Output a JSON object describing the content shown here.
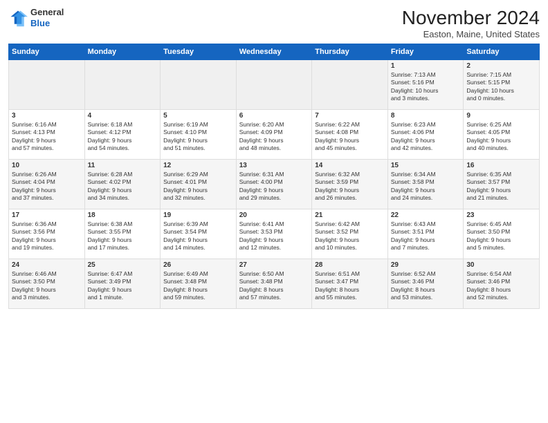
{
  "header": {
    "logo_line1": "General",
    "logo_line2": "Blue",
    "title": "November 2024",
    "subtitle": "Easton, Maine, United States"
  },
  "days_of_week": [
    "Sunday",
    "Monday",
    "Tuesday",
    "Wednesday",
    "Thursday",
    "Friday",
    "Saturday"
  ],
  "weeks": [
    [
      {
        "num": "",
        "info": ""
      },
      {
        "num": "",
        "info": ""
      },
      {
        "num": "",
        "info": ""
      },
      {
        "num": "",
        "info": ""
      },
      {
        "num": "",
        "info": ""
      },
      {
        "num": "1",
        "info": "Sunrise: 7:13 AM\nSunset: 5:16 PM\nDaylight: 10 hours\nand 3 minutes."
      },
      {
        "num": "2",
        "info": "Sunrise: 7:15 AM\nSunset: 5:15 PM\nDaylight: 10 hours\nand 0 minutes."
      }
    ],
    [
      {
        "num": "3",
        "info": "Sunrise: 6:16 AM\nSunset: 4:13 PM\nDaylight: 9 hours\nand 57 minutes."
      },
      {
        "num": "4",
        "info": "Sunrise: 6:18 AM\nSunset: 4:12 PM\nDaylight: 9 hours\nand 54 minutes."
      },
      {
        "num": "5",
        "info": "Sunrise: 6:19 AM\nSunset: 4:10 PM\nDaylight: 9 hours\nand 51 minutes."
      },
      {
        "num": "6",
        "info": "Sunrise: 6:20 AM\nSunset: 4:09 PM\nDaylight: 9 hours\nand 48 minutes."
      },
      {
        "num": "7",
        "info": "Sunrise: 6:22 AM\nSunset: 4:08 PM\nDaylight: 9 hours\nand 45 minutes."
      },
      {
        "num": "8",
        "info": "Sunrise: 6:23 AM\nSunset: 4:06 PM\nDaylight: 9 hours\nand 42 minutes."
      },
      {
        "num": "9",
        "info": "Sunrise: 6:25 AM\nSunset: 4:05 PM\nDaylight: 9 hours\nand 40 minutes."
      }
    ],
    [
      {
        "num": "10",
        "info": "Sunrise: 6:26 AM\nSunset: 4:04 PM\nDaylight: 9 hours\nand 37 minutes."
      },
      {
        "num": "11",
        "info": "Sunrise: 6:28 AM\nSunset: 4:02 PM\nDaylight: 9 hours\nand 34 minutes."
      },
      {
        "num": "12",
        "info": "Sunrise: 6:29 AM\nSunset: 4:01 PM\nDaylight: 9 hours\nand 32 minutes."
      },
      {
        "num": "13",
        "info": "Sunrise: 6:31 AM\nSunset: 4:00 PM\nDaylight: 9 hours\nand 29 minutes."
      },
      {
        "num": "14",
        "info": "Sunrise: 6:32 AM\nSunset: 3:59 PM\nDaylight: 9 hours\nand 26 minutes."
      },
      {
        "num": "15",
        "info": "Sunrise: 6:34 AM\nSunset: 3:58 PM\nDaylight: 9 hours\nand 24 minutes."
      },
      {
        "num": "16",
        "info": "Sunrise: 6:35 AM\nSunset: 3:57 PM\nDaylight: 9 hours\nand 21 minutes."
      }
    ],
    [
      {
        "num": "17",
        "info": "Sunrise: 6:36 AM\nSunset: 3:56 PM\nDaylight: 9 hours\nand 19 minutes."
      },
      {
        "num": "18",
        "info": "Sunrise: 6:38 AM\nSunset: 3:55 PM\nDaylight: 9 hours\nand 17 minutes."
      },
      {
        "num": "19",
        "info": "Sunrise: 6:39 AM\nSunset: 3:54 PM\nDaylight: 9 hours\nand 14 minutes."
      },
      {
        "num": "20",
        "info": "Sunrise: 6:41 AM\nSunset: 3:53 PM\nDaylight: 9 hours\nand 12 minutes."
      },
      {
        "num": "21",
        "info": "Sunrise: 6:42 AM\nSunset: 3:52 PM\nDaylight: 9 hours\nand 10 minutes."
      },
      {
        "num": "22",
        "info": "Sunrise: 6:43 AM\nSunset: 3:51 PM\nDaylight: 9 hours\nand 7 minutes."
      },
      {
        "num": "23",
        "info": "Sunrise: 6:45 AM\nSunset: 3:50 PM\nDaylight: 9 hours\nand 5 minutes."
      }
    ],
    [
      {
        "num": "24",
        "info": "Sunrise: 6:46 AM\nSunset: 3:50 PM\nDaylight: 9 hours\nand 3 minutes."
      },
      {
        "num": "25",
        "info": "Sunrise: 6:47 AM\nSunset: 3:49 PM\nDaylight: 9 hours\nand 1 minute."
      },
      {
        "num": "26",
        "info": "Sunrise: 6:49 AM\nSunset: 3:48 PM\nDaylight: 8 hours\nand 59 minutes."
      },
      {
        "num": "27",
        "info": "Sunrise: 6:50 AM\nSunset: 3:48 PM\nDaylight: 8 hours\nand 57 minutes."
      },
      {
        "num": "28",
        "info": "Sunrise: 6:51 AM\nSunset: 3:47 PM\nDaylight: 8 hours\nand 55 minutes."
      },
      {
        "num": "29",
        "info": "Sunrise: 6:52 AM\nSunset: 3:46 PM\nDaylight: 8 hours\nand 53 minutes."
      },
      {
        "num": "30",
        "info": "Sunrise: 6:54 AM\nSunset: 3:46 PM\nDaylight: 8 hours\nand 52 minutes."
      }
    ]
  ]
}
